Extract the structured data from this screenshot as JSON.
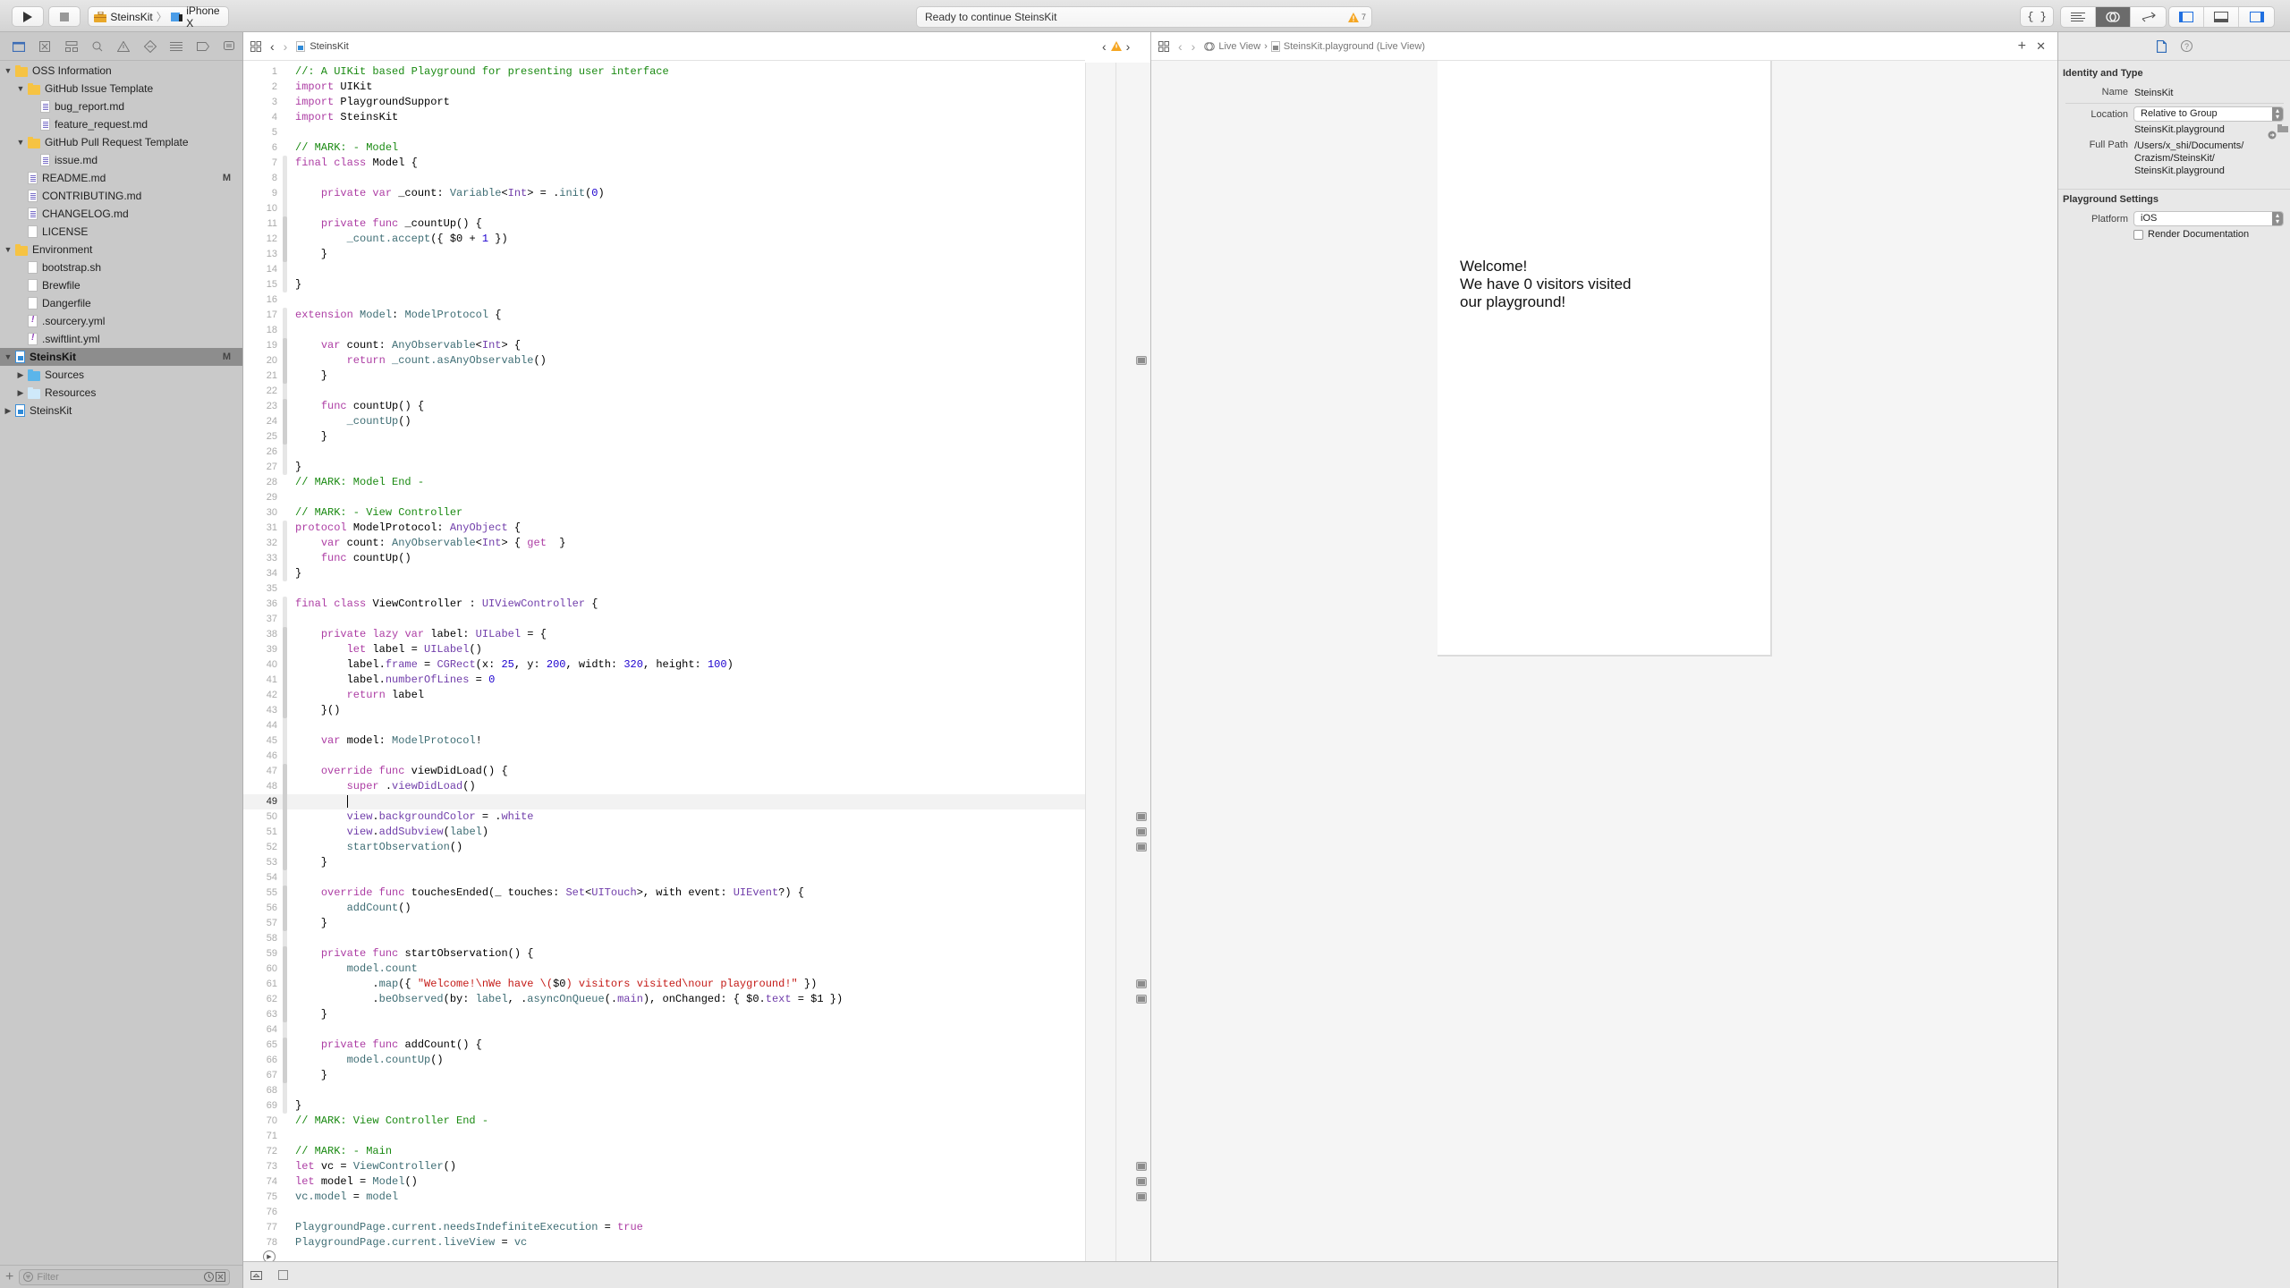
{
  "toolbar": {
    "run_icon": "play-icon",
    "stop_icon": "stop-icon",
    "scheme": "SteinsKit",
    "destination": "iPhone X",
    "status": "Ready to continue SteinsKit",
    "warning_count": "7",
    "right_buttons": [
      "library-icon",
      "standard-editor-icon",
      "assistant-editor-icon",
      "version-editor-icon",
      "navigator-toggle-icon",
      "debug-area-toggle-icon",
      "inspector-toggle-icon"
    ]
  },
  "navigator": {
    "tabs": [
      "project-navigator-icon",
      "source-control-icon",
      "symbol-navigator-icon",
      "find-navigator-icon",
      "issue-navigator-icon",
      "test-navigator-icon",
      "debug-navigator-icon",
      "breakpoint-navigator-icon",
      "report-navigator-icon"
    ],
    "items": [
      {
        "label": "OSS Information",
        "type": "folder",
        "depth": 0,
        "expanded": true
      },
      {
        "label": "GitHub Issue Template",
        "type": "folder",
        "depth": 1,
        "expanded": true
      },
      {
        "label": "bug_report.md",
        "type": "md",
        "depth": 2
      },
      {
        "label": "feature_request.md",
        "type": "md",
        "depth": 2
      },
      {
        "label": "GitHub Pull Request Template",
        "type": "folder",
        "depth": 1,
        "expanded": true
      },
      {
        "label": "issue.md",
        "type": "md",
        "depth": 2
      },
      {
        "label": "README.md",
        "type": "md",
        "depth": 1,
        "badge": "M"
      },
      {
        "label": "CONTRIBUTING.md",
        "type": "md",
        "depth": 1
      },
      {
        "label": "CHANGELOG.md",
        "type": "md",
        "depth": 1
      },
      {
        "label": "LICENSE",
        "type": "text",
        "depth": 1
      },
      {
        "label": "Environment",
        "type": "folder",
        "depth": 0,
        "expanded": true
      },
      {
        "label": "bootstrap.sh",
        "type": "text",
        "depth": 1
      },
      {
        "label": "Brewfile",
        "type": "text",
        "depth": 1
      },
      {
        "label": "Dangerfile",
        "type": "text",
        "depth": 1
      },
      {
        "label": ".sourcery.yml",
        "type": "yml",
        "depth": 1
      },
      {
        "label": ".swiftlint.yml",
        "type": "yml",
        "depth": 1
      },
      {
        "label": "SteinsKit",
        "type": "playground",
        "depth": 0,
        "expanded": true,
        "badge": "M",
        "selected": true
      },
      {
        "label": "Sources",
        "type": "folder-blue",
        "depth": 1,
        "expanded": false
      },
      {
        "label": "Resources",
        "type": "folder-lblue",
        "depth": 1,
        "expanded": false
      },
      {
        "label": "SteinsKit",
        "type": "project",
        "depth": 0,
        "expanded": false
      }
    ],
    "filter_placeholder": "Filter"
  },
  "editor": {
    "breadcrumb": "SteinsKit",
    "current_line": 49,
    "lines": [
      [
        [
          "c",
          "//: A UIKit based Playground for presenting user interface"
        ]
      ],
      [
        [
          "k",
          "import"
        ],
        [
          "",
          "UIKit"
        ]
      ],
      [
        [
          "k",
          "import"
        ],
        [
          "",
          "PlaygroundSupport"
        ]
      ],
      [
        [
          "k",
          "import"
        ],
        [
          "",
          "SteinsKit"
        ]
      ],
      [],
      [
        [
          "c",
          "// MARK: - Model"
        ]
      ],
      [
        [
          "k",
          "final"
        ],
        [
          "k",
          "class"
        ],
        [
          "",
          "Model {"
        ]
      ],
      [],
      [
        [
          "",
          "    "
        ],
        [
          "k",
          "private"
        ],
        [
          "k",
          "var"
        ],
        [
          "",
          "_count: "
        ],
        [
          "t",
          "Variable"
        ],
        [
          "",
          "<"
        ],
        [
          "p",
          "Int"
        ],
        [
          "",
          "> = ."
        ],
        [
          "t",
          "init"
        ],
        [
          "",
          "("
        ],
        [
          "n",
          "0"
        ],
        [
          "",
          ")"
        ]
      ],
      [],
      [
        [
          "",
          "    "
        ],
        [
          "k",
          "private"
        ],
        [
          "k",
          "func"
        ],
        [
          "",
          "_countUp() {"
        ]
      ],
      [
        [
          "",
          "        "
        ],
        [
          "t",
          "_count.accept"
        ],
        [
          "",
          "({ $0 + "
        ],
        [
          "n",
          "1"
        ],
        [
          "",
          " })"
        ]
      ],
      [
        [
          "",
          "    }"
        ]
      ],
      [],
      [
        [
          "",
          "}"
        ]
      ],
      [],
      [
        [
          "k",
          "extension"
        ],
        [
          "t",
          "Model"
        ],
        [
          "",
          ": "
        ],
        [
          "t",
          "ModelProtocol"
        ],
        [
          "",
          " {"
        ]
      ],
      [],
      [
        [
          "",
          "    "
        ],
        [
          "k",
          "var"
        ],
        [
          "",
          "count: "
        ],
        [
          "t",
          "AnyObservable"
        ],
        [
          "",
          "<"
        ],
        [
          "p",
          "Int"
        ],
        [
          "",
          "> {"
        ]
      ],
      [
        [
          "",
          "        "
        ],
        [
          "k",
          "return"
        ],
        [
          "t",
          "_count.asAnyObservable"
        ],
        [
          "",
          "()"
        ]
      ],
      [
        [
          "",
          "    }"
        ]
      ],
      [],
      [
        [
          "",
          "    "
        ],
        [
          "k",
          "func"
        ],
        [
          "",
          "countUp() {"
        ]
      ],
      [
        [
          "",
          "        "
        ],
        [
          "t",
          "_countUp"
        ],
        [
          "",
          "()"
        ]
      ],
      [
        [
          "",
          "    }"
        ]
      ],
      [],
      [
        [
          "",
          "}"
        ]
      ],
      [
        [
          "c",
          "// MARK: Model End -"
        ]
      ],
      [],
      [
        [
          "c",
          "// MARK: - View Controller"
        ]
      ],
      [
        [
          "k",
          "protocol"
        ],
        [
          "",
          "ModelProtocol: "
        ],
        [
          "p",
          "AnyObject"
        ],
        [
          "",
          " {"
        ]
      ],
      [
        [
          "",
          "    "
        ],
        [
          "k",
          "var"
        ],
        [
          "",
          "count: "
        ],
        [
          "t",
          "AnyObservable"
        ],
        [
          "",
          "<"
        ],
        [
          "p",
          "Int"
        ],
        [
          "",
          "> { "
        ],
        [
          "k",
          "get"
        ],
        [
          "",
          " }"
        ]
      ],
      [
        [
          "",
          "    "
        ],
        [
          "k",
          "func"
        ],
        [
          "",
          "countUp()"
        ]
      ],
      [
        [
          "",
          "}"
        ]
      ],
      [],
      [
        [
          "k",
          "final"
        ],
        [
          "k",
          "class"
        ],
        [
          "",
          "ViewController : "
        ],
        [
          "p",
          "UIViewController"
        ],
        [
          "",
          " {"
        ]
      ],
      [],
      [
        [
          "",
          "    "
        ],
        [
          "k",
          "private"
        ],
        [
          "k",
          "lazy"
        ],
        [
          "k",
          "var"
        ],
        [
          "",
          "label: "
        ],
        [
          "p",
          "UILabel"
        ],
        [
          "",
          " = {"
        ]
      ],
      [
        [
          "",
          "        "
        ],
        [
          "k",
          "let"
        ],
        [
          "",
          "label = "
        ],
        [
          "p",
          "UILabel"
        ],
        [
          "",
          "()"
        ]
      ],
      [
        [
          "",
          "        label."
        ],
        [
          "p",
          "frame"
        ],
        [
          "",
          " = "
        ],
        [
          "p",
          "CGRect"
        ],
        [
          "",
          "(x: "
        ],
        [
          "n",
          "25"
        ],
        [
          "",
          ", y: "
        ],
        [
          "n",
          "200"
        ],
        [
          "",
          ", width: "
        ],
        [
          "n",
          "320"
        ],
        [
          "",
          ", height: "
        ],
        [
          "n",
          "100"
        ],
        [
          "",
          ")"
        ]
      ],
      [
        [
          "",
          "        label."
        ],
        [
          "p",
          "numberOfLines"
        ],
        [
          "",
          " = "
        ],
        [
          "n",
          "0"
        ]
      ],
      [
        [
          "",
          "        "
        ],
        [
          "k",
          "return"
        ],
        [
          "",
          "label"
        ]
      ],
      [
        [
          "",
          "    }()"
        ]
      ],
      [],
      [
        [
          "",
          "    "
        ],
        [
          "k",
          "var"
        ],
        [
          "",
          "model: "
        ],
        [
          "t",
          "ModelProtocol"
        ],
        [
          "",
          "!"
        ]
      ],
      [],
      [
        [
          "",
          "    "
        ],
        [
          "k",
          "override"
        ],
        [
          "k",
          "func"
        ],
        [
          "",
          "viewDidLoad() {"
        ]
      ],
      [
        [
          "",
          "        "
        ],
        [
          "k",
          "super"
        ],
        [
          "",
          "."
        ],
        [
          "p",
          "viewDidLoad"
        ],
        [
          "",
          "()"
        ]
      ],
      [
        [
          "caret",
          ""
        ]
      ],
      [
        [
          "",
          "        "
        ],
        [
          "p",
          "view"
        ],
        [
          "",
          "."
        ],
        [
          "p",
          "backgroundColor"
        ],
        [
          "",
          " = ."
        ],
        [
          "p",
          "white"
        ]
      ],
      [
        [
          "",
          "        "
        ],
        [
          "p",
          "view"
        ],
        [
          "",
          "."
        ],
        [
          "p",
          "addSubview"
        ],
        [
          "",
          "("
        ],
        [
          "t",
          "label"
        ],
        [
          "",
          ")"
        ]
      ],
      [
        [
          "",
          "        "
        ],
        [
          "t",
          "startObservation"
        ],
        [
          "",
          "()"
        ]
      ],
      [
        [
          "",
          "    }"
        ]
      ],
      [],
      [
        [
          "",
          "    "
        ],
        [
          "k",
          "override"
        ],
        [
          "k",
          "func"
        ],
        [
          "",
          "touchesEnded(_ touches: "
        ],
        [
          "p",
          "Set"
        ],
        [
          "",
          "<"
        ],
        [
          "p",
          "UITouch"
        ],
        [
          "",
          ">, with event: "
        ],
        [
          "p",
          "UIEvent"
        ],
        [
          "",
          "?) {"
        ]
      ],
      [
        [
          "",
          "        "
        ],
        [
          "t",
          "addCount"
        ],
        [
          "",
          "()"
        ]
      ],
      [
        [
          "",
          "    }"
        ]
      ],
      [],
      [
        [
          "",
          "    "
        ],
        [
          "k",
          "private"
        ],
        [
          "k",
          "func"
        ],
        [
          "",
          "startObservation() {"
        ]
      ],
      [
        [
          "",
          "        "
        ],
        [
          "t",
          "model.count"
        ]
      ],
      [
        [
          "",
          "            ."
        ],
        [
          "t",
          "map"
        ],
        [
          "",
          "({ "
        ],
        [
          "s",
          "\"Welcome!\\nWe have \\("
        ],
        [
          "",
          "$0"
        ],
        [
          "s",
          ") visitors visited\\nour playground!\""
        ],
        [
          "",
          " })"
        ]
      ],
      [
        [
          "",
          "            ."
        ],
        [
          "t",
          "beObserved"
        ],
        [
          "",
          "(by: "
        ],
        [
          "t",
          "label"
        ],
        [
          "",
          ", ."
        ],
        [
          "t",
          "asyncOnQueue"
        ],
        [
          "",
          "(."
        ],
        [
          "p",
          "main"
        ],
        [
          "",
          "), onChanged: { $0."
        ],
        [
          "p",
          "text"
        ],
        [
          "",
          " = $1 })"
        ]
      ],
      [
        [
          "",
          "    }"
        ]
      ],
      [],
      [
        [
          "",
          "    "
        ],
        [
          "k",
          "private"
        ],
        [
          "k",
          "func"
        ],
        [
          "",
          "addCount() {"
        ]
      ],
      [
        [
          "",
          "        "
        ],
        [
          "t",
          "model.countUp"
        ],
        [
          "",
          "()"
        ]
      ],
      [
        [
          "",
          "    }"
        ]
      ],
      [],
      [
        [
          "",
          "}"
        ]
      ],
      [
        [
          "c",
          "// MARK: View Controller End -"
        ]
      ],
      [],
      [
        [
          "c",
          "// MARK: - Main"
        ]
      ],
      [
        [
          "k",
          "let"
        ],
        [
          "",
          "vc = "
        ],
        [
          "t",
          "ViewController"
        ],
        [
          "",
          "()"
        ]
      ],
      [
        [
          "k",
          "let"
        ],
        [
          "",
          "model = "
        ],
        [
          "t",
          "Model"
        ],
        [
          "",
          "()"
        ]
      ],
      [
        [
          "t",
          "vc.model"
        ],
        [
          "",
          " = "
        ],
        [
          "t",
          "model"
        ]
      ],
      [],
      [
        [
          "t",
          "PlaygroundPage.current.needsIndefiniteExecution"
        ],
        [
          "",
          " = "
        ],
        [
          "k",
          "true"
        ]
      ],
      [
        [
          "t",
          "PlaygroundPage.current.liveView"
        ],
        [
          "",
          " = "
        ],
        [
          "t",
          "vc"
        ]
      ]
    ],
    "result_markers": [
      20,
      50,
      51,
      52,
      61,
      62,
      73,
      74,
      75
    ]
  },
  "liveview": {
    "breadcrumb_1": "Live View",
    "breadcrumb_2": "SteinsKit.playground (Live View)",
    "label_text": "Welcome!\nWe have 0 visitors visited\nour playground!"
  },
  "inspector": {
    "identity_title": "Identity and Type",
    "name_label": "Name",
    "name_value": "SteinsKit",
    "location_label": "Location",
    "location_value": "Relative to Group",
    "file_name": "SteinsKit.playground",
    "fullpath_label": "Full Path",
    "fullpath_value": "/Users/x_shi/Documents/\nCrazism/SteinsKit/\nSteinsKit.playground",
    "playground_title": "Playground Settings",
    "platform_label": "Platform",
    "platform_value": "iOS",
    "render_doc_label": "Render Documentation",
    "render_doc_checked": false
  }
}
